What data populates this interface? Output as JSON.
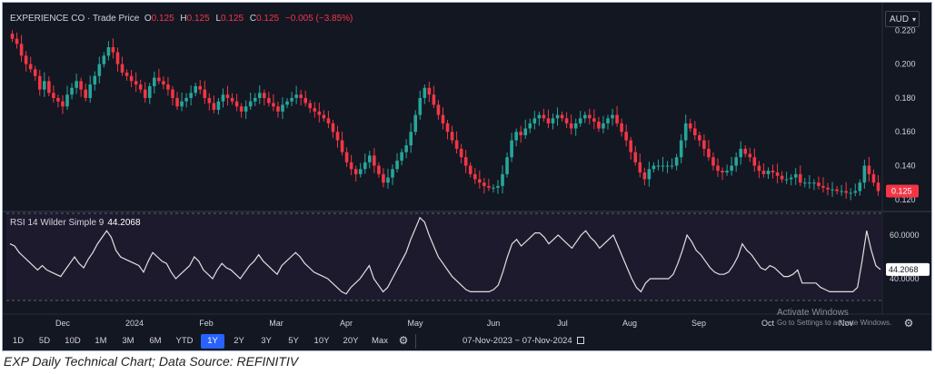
{
  "header": {
    "title": "EXPERIENCE CO · Trade Price",
    "open_label": "O",
    "open": "0.125",
    "high_label": "H",
    "high": "0.125",
    "low_label": "L",
    "low": "0.125",
    "close_label": "C",
    "close": "0.125",
    "change": "−0.005 (−3.85%)"
  },
  "currency": "AUD",
  "rsi": {
    "label": "RSI 14 Wilder Simple 9",
    "value": "44.2068"
  },
  "timeframes": [
    "1D",
    "5D",
    "10D",
    "1M",
    "3M",
    "6M",
    "YTD",
    "1Y",
    "2Y",
    "3Y",
    "5Y",
    "10Y",
    "20Y",
    "Max"
  ],
  "active_timeframe": "1Y",
  "date_range": "07-Nov-2023 − 07-Nov-2024",
  "watermark": {
    "line1": "Activate Windows",
    "line2": "Go to Settings to activate Windows."
  },
  "caption": "EXP Daily Technical Chart; Data Source: REFINITIV",
  "colors": {
    "up": "#26a69a",
    "down": "#f23645",
    "rsi_line": "#e0e0e0",
    "background": "#131722",
    "rsi_band": "#1e1a2e"
  },
  "chart_data": [
    {
      "type": "candlestick",
      "title": "EXPERIENCE CO · Trade Price",
      "x_ticks": [
        "Dec",
        "2024",
        "Feb",
        "Mar",
        "Apr",
        "May",
        "Jun",
        "Jul",
        "Aug",
        "Sep",
        "Oct",
        "Nov"
      ],
      "y_ticks": [
        "0.120",
        "0.140",
        "0.160",
        "0.180",
        "0.200",
        "0.220"
      ],
      "ylim": [
        0.114,
        0.232
      ],
      "last_price_label": "0.125",
      "close": [
        0.215,
        0.212,
        0.205,
        0.2,
        0.197,
        0.193,
        0.185,
        0.19,
        0.183,
        0.18,
        0.178,
        0.175,
        0.182,
        0.186,
        0.19,
        0.185,
        0.18,
        0.188,
        0.193,
        0.2,
        0.205,
        0.21,
        0.207,
        0.2,
        0.195,
        0.193,
        0.19,
        0.188,
        0.185,
        0.18,
        0.187,
        0.192,
        0.19,
        0.188,
        0.185,
        0.18,
        0.175,
        0.178,
        0.18,
        0.183,
        0.187,
        0.185,
        0.18,
        0.177,
        0.173,
        0.178,
        0.182,
        0.18,
        0.178,
        0.175,
        0.172,
        0.175,
        0.178,
        0.18,
        0.183,
        0.18,
        0.177,
        0.175,
        0.172,
        0.176,
        0.178,
        0.18,
        0.182,
        0.18,
        0.177,
        0.174,
        0.172,
        0.17,
        0.168,
        0.165,
        0.16,
        0.155,
        0.148,
        0.142,
        0.138,
        0.135,
        0.138,
        0.142,
        0.146,
        0.14,
        0.135,
        0.13,
        0.133,
        0.138,
        0.143,
        0.148,
        0.152,
        0.16,
        0.17,
        0.18,
        0.186,
        0.182,
        0.176,
        0.17,
        0.165,
        0.16,
        0.155,
        0.15,
        0.145,
        0.14,
        0.135,
        0.132,
        0.13,
        0.128,
        0.127,
        0.127,
        0.128,
        0.135,
        0.145,
        0.155,
        0.16,
        0.158,
        0.162,
        0.165,
        0.168,
        0.17,
        0.168,
        0.165,
        0.168,
        0.17,
        0.168,
        0.165,
        0.162,
        0.165,
        0.168,
        0.17,
        0.168,
        0.166,
        0.162,
        0.165,
        0.168,
        0.17,
        0.165,
        0.16,
        0.155,
        0.148,
        0.142,
        0.136,
        0.132,
        0.138,
        0.14,
        0.14,
        0.14,
        0.14,
        0.14,
        0.145,
        0.155,
        0.165,
        0.162,
        0.158,
        0.155,
        0.15,
        0.145,
        0.14,
        0.137,
        0.136,
        0.137,
        0.14,
        0.145,
        0.15,
        0.147,
        0.145,
        0.14,
        0.137,
        0.135,
        0.137,
        0.136,
        0.134,
        0.132,
        0.132,
        0.133,
        0.135,
        0.13,
        0.13,
        0.13,
        0.13,
        0.128,
        0.127,
        0.126,
        0.126,
        0.125,
        0.125,
        0.124,
        0.124,
        0.125,
        0.13,
        0.14,
        0.135,
        0.13,
        0.125
      ],
      "rsi_series": [
        56,
        55,
        52,
        50,
        48,
        46,
        44,
        46,
        44,
        43,
        42,
        41,
        44,
        47,
        50,
        47,
        45,
        49,
        52,
        56,
        59,
        62,
        59,
        53,
        50,
        49,
        48,
        47,
        46,
        43,
        48,
        52,
        50,
        48,
        47,
        43,
        40,
        42,
        44,
        46,
        50,
        48,
        44,
        42,
        40,
        44,
        47,
        45,
        44,
        42,
        40,
        43,
        46,
        48,
        51,
        48,
        46,
        44,
        42,
        46,
        48,
        50,
        52,
        50,
        47,
        45,
        43,
        42,
        41,
        40,
        38,
        36,
        34,
        33,
        36,
        38,
        40,
        43,
        46,
        40,
        37,
        34,
        36,
        40,
        44,
        48,
        52,
        58,
        63,
        68,
        66,
        60,
        55,
        50,
        47,
        44,
        41,
        39,
        37,
        35,
        34,
        34,
        34,
        34,
        34,
        35,
        37,
        43,
        50,
        56,
        58,
        55,
        57,
        59,
        61,
        61,
        59,
        56,
        58,
        60,
        58,
        56,
        54,
        57,
        60,
        62,
        59,
        57,
        54,
        56,
        58,
        60,
        55,
        50,
        45,
        40,
        36,
        34,
        38,
        40,
        40,
        40,
        40,
        40,
        42,
        47,
        53,
        60,
        57,
        53,
        51,
        48,
        45,
        43,
        42,
        42,
        43,
        46,
        50,
        56,
        53,
        51,
        48,
        45,
        44,
        46,
        45,
        43,
        41,
        41,
        42,
        44,
        38,
        38,
        38,
        38,
        36,
        35,
        34,
        34,
        34,
        34,
        34,
        34,
        36,
        48,
        62,
        53,
        46,
        44.2
      ],
      "rsi_ticks": [
        "40.0000",
        "60.0000"
      ],
      "rsi_last": "44.2068"
    }
  ]
}
